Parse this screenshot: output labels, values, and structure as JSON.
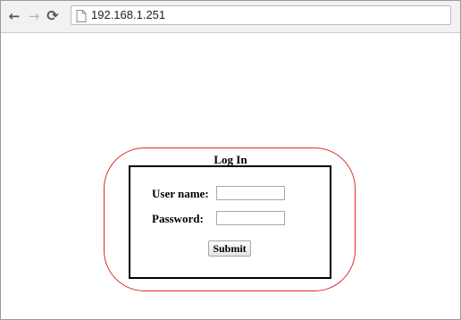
{
  "browser": {
    "back_icon": "arrow-left-icon",
    "forward_icon": "arrow-right-icon",
    "reload_icon": "reload-icon",
    "page_icon": "page-icon",
    "url": "192.168.1.251"
  },
  "login": {
    "title": "Log In",
    "username_label": "User name:",
    "username_value": "",
    "password_label": "Password:",
    "password_value": "",
    "submit_label": "Submit"
  },
  "colors": {
    "outline_accent": "#e0282a",
    "box_border": "#000000"
  }
}
